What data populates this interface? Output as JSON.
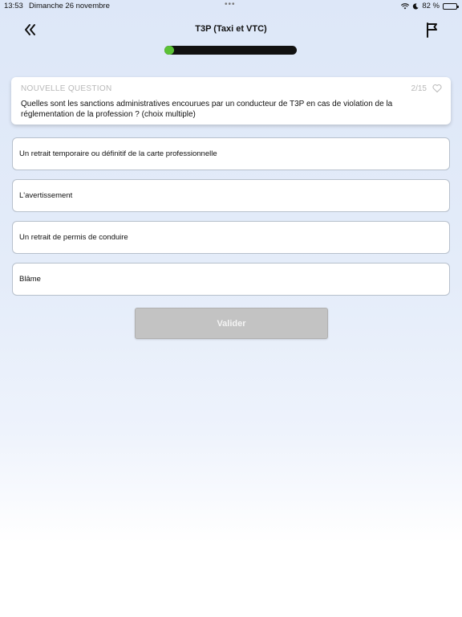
{
  "status_bar": {
    "time": "13:53",
    "date": "Dimanche 26 novembre",
    "dots": "•••",
    "battery_percent": "82 %",
    "battery_level": 0.82
  },
  "header": {
    "title": "T3P (Taxi et VTC)",
    "back_icon": "chevrons-left-icon",
    "flag_icon": "flag-icon"
  },
  "progress": {
    "current": 2,
    "total": 15,
    "fill_fraction": 0.07,
    "fill_color": "#5bc236",
    "track_color": "#111111"
  },
  "question": {
    "label": "NOUVELLE QUESTION",
    "counter": "2/15",
    "text": "Quelles sont les sanctions administratives encourues par un conducteur de T3P en cas de violation de la réglementation de la profession ? (choix multiple)",
    "favorite_icon": "heart-icon"
  },
  "answers": [
    "Un retrait temporaire ou définitif de la carte professionnelle",
    "L'avertissement",
    "Un retrait de permis de conduire",
    "Blâme"
  ],
  "validate": {
    "label": "Valider",
    "disabled_color": "#c3c3c3"
  }
}
